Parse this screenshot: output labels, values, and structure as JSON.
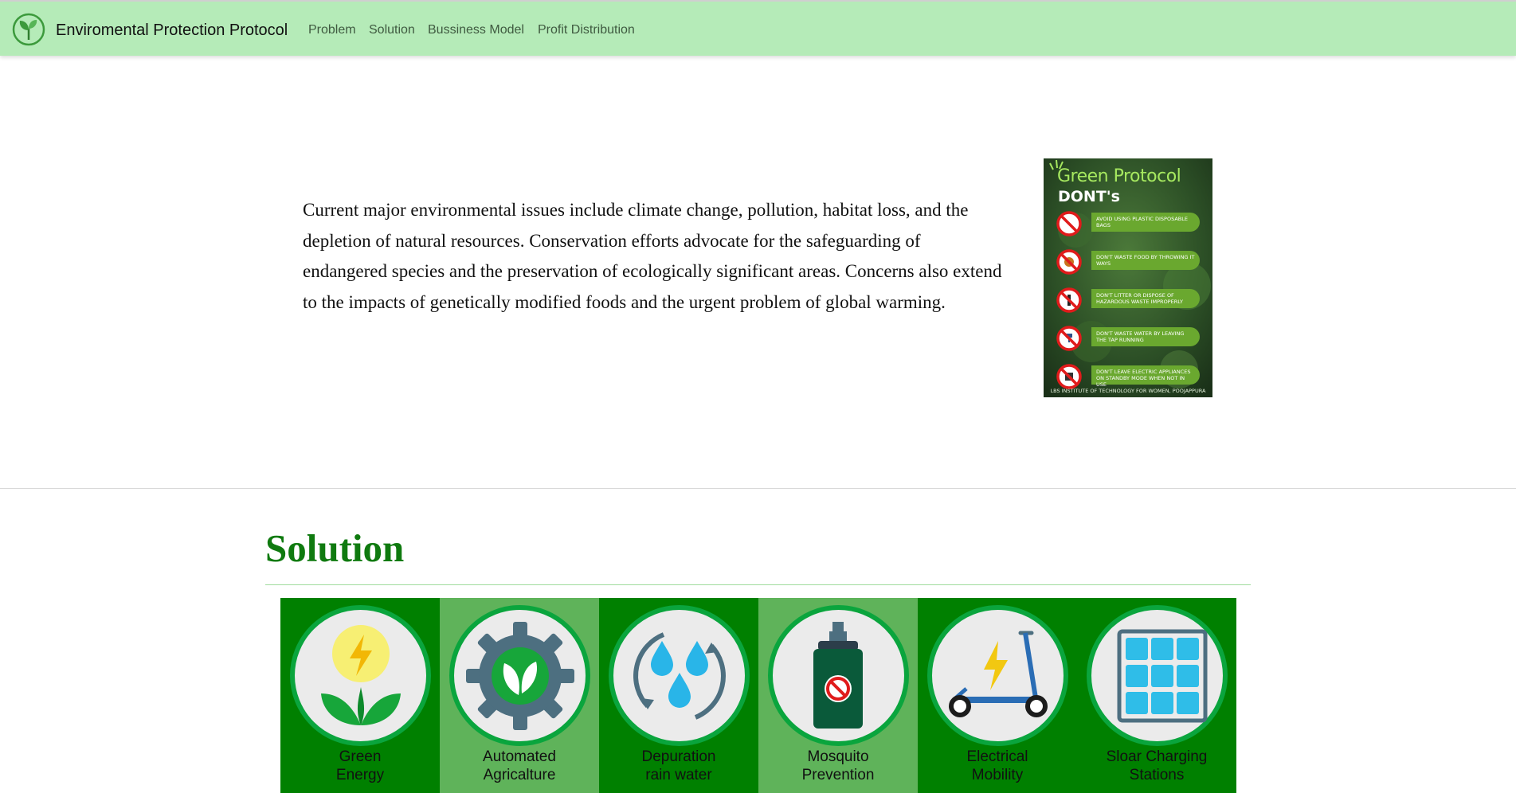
{
  "navbar": {
    "brand": "Enviromental Protection Protocol",
    "links": [
      "Problem",
      "Solution",
      "Bussiness Model",
      "Profit Distribution"
    ]
  },
  "problem": {
    "text": "Current major environmental issues include climate change, pollution, habitat loss, and the depletion of natural resources. Conservation efforts advocate for the safeguarding of endangered species and the preservation of ecologically significant areas. Concerns also extend to the impacts of genetically modified foods and the urgent problem of global warming."
  },
  "poster": {
    "title": "Green Protocol",
    "subtitle": "DONT's",
    "items": [
      "AVOID USING PLASTIC DISPOSABLE BAGS",
      "DON'T WASTE FOOD BY THROWING IT WAYS",
      "DON'T LITTER OR DISPOSE OF HAZARDOUS WASTE IMPROPERLY",
      "DON'T WASTE WATER BY LEAVING THE TAP RUNNING",
      "DON'T LEAVE ELECTRIC APPLIANCES ON STANDBY MODE WHEN NOT IN USE"
    ],
    "footer": "LBS INSTITUTE OF TECHNOLOGY FOR WOMEN, POOJAPPURA"
  },
  "solution": {
    "heading": "Solution",
    "tiles": [
      {
        "label": "Green\nEnergy",
        "icon": "green-energy-icon"
      },
      {
        "label": "Automated\nAgricalture",
        "icon": "automated-agriculture-icon"
      },
      {
        "label": "Depuration\nrain water",
        "icon": "rain-water-icon"
      },
      {
        "label": "Mosquito\nPrevention",
        "icon": "mosquito-spray-icon"
      },
      {
        "label": "Electrical\nMobility",
        "icon": "electric-scooter-icon"
      },
      {
        "label": "Sloar Charging\nStations",
        "icon": "solar-panel-icon"
      }
    ]
  },
  "colors": {
    "navbar_bg": "#b5ebb8",
    "heading_green": "#0f7a0f",
    "tile_dark": "#008000",
    "tile_light": "#5fb35a",
    "circle_border": "#0aa53d"
  }
}
